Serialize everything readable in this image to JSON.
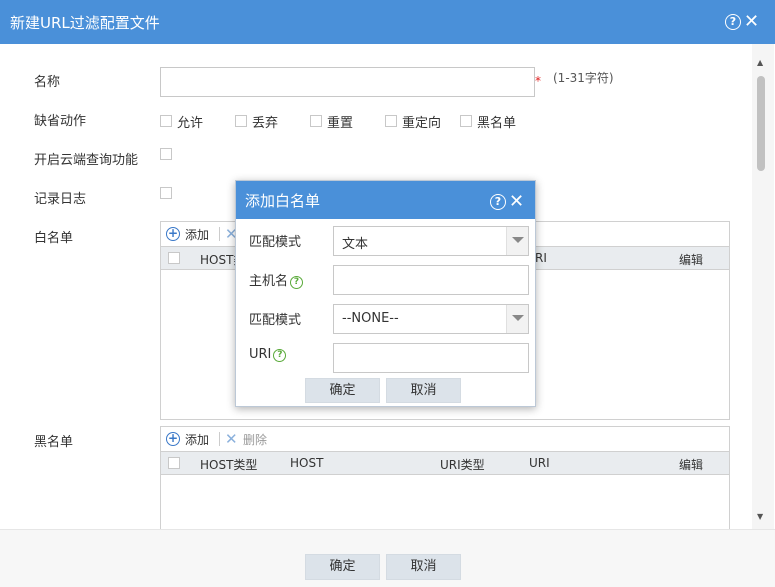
{
  "window": {
    "title": "新建URL过滤配置文件",
    "help": "?",
    "close": "✕"
  },
  "form": {
    "name_label": "名称",
    "name_value": "",
    "required_mark": "*",
    "name_hint": "(1-31字符)",
    "default_action_label": "缺省动作",
    "default_actions": [
      "允许",
      "丢弃",
      "重置",
      "重定向",
      "黑名单"
    ],
    "cloud_query_label": "开启云端查询功能",
    "log_label": "记录日志",
    "whitelist_label": "白名单",
    "blacklist_label": "黑名单"
  },
  "grid": {
    "add_icon": "+",
    "add_label": "添加",
    "delete_icon": "✕",
    "delete_label": "删除",
    "columns": [
      "HOST类型",
      "HOST",
      "URI类型",
      "URI",
      "编辑"
    ],
    "whitelist_visible_columns": [
      "HOST类",
      "RI",
      "编辑"
    ]
  },
  "scrollbar": {
    "up": "▲",
    "down": "▼"
  },
  "footer": {
    "ok_label": "确定",
    "cancel_label": "取消"
  },
  "modal": {
    "title": "添加白名单",
    "help": "?",
    "close": "✕",
    "host_match_label": "匹配模式",
    "host_match_value": "文本",
    "hostname_label": "主机名",
    "hostname_value": "",
    "uri_match_label": "匹配模式",
    "uri_match_value": "--NONE--",
    "uri_label": "URI",
    "uri_value": "",
    "q": "?",
    "ok_label": "确定",
    "cancel_label": "取消"
  },
  "colors": {
    "titlebar": "#4a90d9",
    "button_bg": "#dce3ea",
    "required": "#e02020",
    "help_green": "#5aaa3a",
    "add_blue": "#3a78c8"
  }
}
